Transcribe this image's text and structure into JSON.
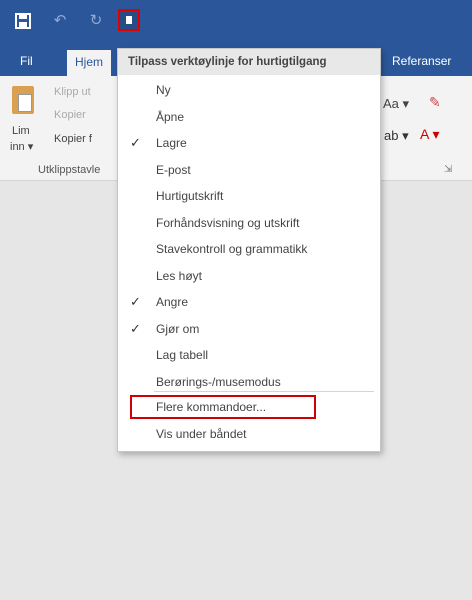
{
  "window": {
    "qat": {
      "save_icon": "save-icon",
      "undo_icon": "undo-icon",
      "redo_icon": "redo-icon",
      "dropdown_icon": "customize-qat-icon"
    },
    "tabs": {
      "fil": "Fil",
      "hjem": "Hjem",
      "referanser": "Referanser"
    },
    "accent_color": "#2b579a",
    "highlight_color": "#d00000"
  },
  "ribbon": {
    "clipboard": {
      "lim_inn_line1": "Lim",
      "lim_inn_line2": "inn ▾",
      "klipp_ut": "Klipp ut",
      "kopier": "Kopier",
      "kopier_format": "Kopier f",
      "group_label": "Utklippstavle"
    },
    "font": {
      "aa": "Aa ▾",
      "highlight": "ab ▾",
      "font_color": "A ▾"
    }
  },
  "menu": {
    "header": "Tilpass verktøylinje for hurtigtilgang",
    "items": [
      {
        "label": "Ny",
        "checked": false
      },
      {
        "label": "Åpne",
        "checked": false
      },
      {
        "label": "Lagre",
        "checked": true
      },
      {
        "label": "E-post",
        "checked": false
      },
      {
        "label": "Hurtigutskrift",
        "checked": false
      },
      {
        "label": "Forhåndsvisning og utskrift",
        "checked": false
      },
      {
        "label": "Stavekontroll og grammatikk",
        "checked": false
      },
      {
        "label": "Les høyt",
        "checked": false
      },
      {
        "label": "Angre",
        "checked": true
      },
      {
        "label": "Gjør om",
        "checked": true
      },
      {
        "label": "Lag tabell",
        "checked": false
      },
      {
        "label": "Berørings-/musemodus",
        "checked": false
      }
    ],
    "more_commands": "Flere kommandoer...",
    "show_below": "Vis under båndet",
    "check_mark": "✓"
  }
}
